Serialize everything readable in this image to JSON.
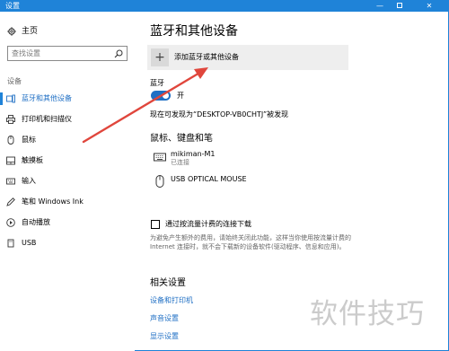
{
  "window": {
    "title": "设置",
    "minimize_glyph": "—",
    "close_glyph": "✕"
  },
  "sidebar": {
    "home_label": "主页",
    "search_placeholder": "查找设置",
    "section_label": "设备",
    "items": [
      {
        "label": "蓝牙和其他设备",
        "icon": "bluetooth-devices-icon",
        "active": true
      },
      {
        "label": "打印机和扫描仪",
        "icon": "printer-icon",
        "active": false
      },
      {
        "label": "鼠标",
        "icon": "mouse-icon",
        "active": false
      },
      {
        "label": "触摸板",
        "icon": "touchpad-icon",
        "active": false
      },
      {
        "label": "输入",
        "icon": "keyboard-icon",
        "active": false
      },
      {
        "label": "笔和 Windows Ink",
        "icon": "pen-icon",
        "active": false
      },
      {
        "label": "自动播放",
        "icon": "autoplay-icon",
        "active": false
      },
      {
        "label": "USB",
        "icon": "usb-icon",
        "active": false
      }
    ]
  },
  "main": {
    "title": "蓝牙和其他设备",
    "add_device_label": "添加蓝牙或其他设备",
    "add_plus": "+",
    "bluetooth_label": "蓝牙",
    "bluetooth_state": "开",
    "discoverable_text": "现在可发现为“DESKTOP-VB0CHTJ”被发现",
    "peripherals_heading": "鼠标、键盘和笔",
    "devices": [
      {
        "name": "mikiman-M1",
        "status": "已连接",
        "icon": "keyboard-icon"
      },
      {
        "name": "USB OPTICAL MOUSE",
        "status": "",
        "icon": "mouse-icon"
      }
    ],
    "metered_label": "通过按流量计费的连接下载",
    "metered_desc": "为避免产生额外的费用，请始终关闭此功能，这样当你使用按流量计费的 Internet 连接时，就不会下载新的设备软件(驱动程序、信息和应用)。",
    "related_heading": "相关设置",
    "related_links": [
      "设备和打印机",
      "声音设置",
      "显示设置"
    ]
  },
  "watermark": "软件技巧",
  "colors": {
    "accent": "#1f83d8",
    "link": "#1f6fc4",
    "annotation_arrow": "#e0463c"
  }
}
